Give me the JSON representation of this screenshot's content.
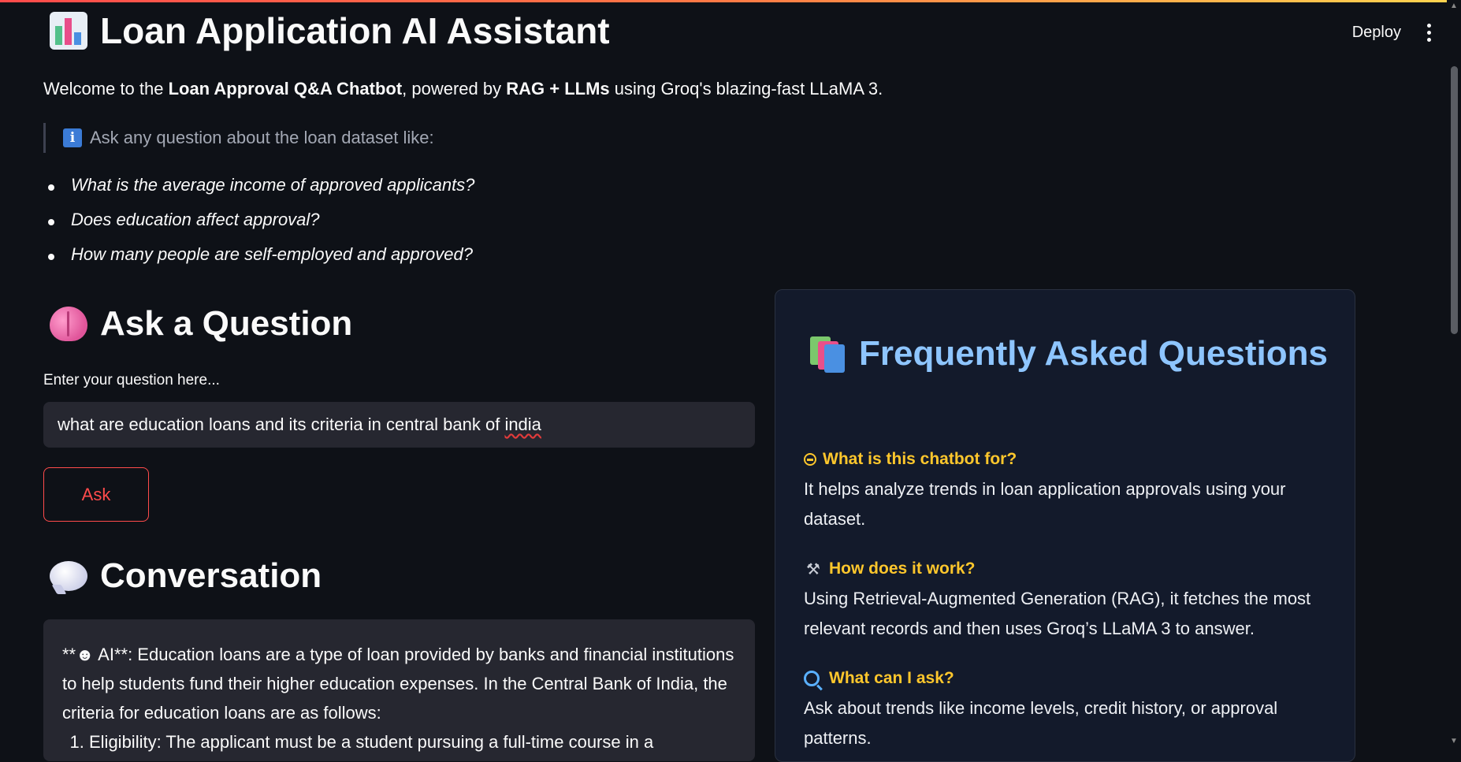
{
  "header": {
    "deploy_label": "Deploy",
    "menu_icon": "more-vertical-icon"
  },
  "app": {
    "title": "Loan Application AI Assistant",
    "title_icon": "bar-chart-icon"
  },
  "welcome": {
    "prefix": "Welcome to the ",
    "bold1": "Loan Approval Q&A Chatbot",
    "middle": ", powered by ",
    "bold2": "RAG + LLMs",
    "suffix": " using Groq's blazing-fast LLaMA 3."
  },
  "hint": {
    "icon": "info-icon",
    "text": "Ask any question about the loan dataset like:"
  },
  "examples": [
    "What is the average income of approved applicants?",
    "Does education affect approval?",
    "How many people are self-employed and approved?"
  ],
  "ask_section": {
    "title": "Ask a Question",
    "icon": "brain-icon",
    "input_label": "Enter your question here...",
    "input_value_main": "what are education loans and its criteria in central bank of ",
    "input_value_misspelled": "india",
    "button_label": "Ask"
  },
  "conversation": {
    "title": "Conversation",
    "icon": "speech-bubble-icon",
    "answer_line1": "**☻ AI**: Education loans are a type of loan provided by banks and financial institutions to help students fund their higher education expenses. In the Central Bank of India, the criteria for education loans are as follows:",
    "answer_item1": "Eligibility: The applicant must be a student pursuing a full-time course in a"
  },
  "faq": {
    "title": "Frequently Asked Questions",
    "icon": "books-icon",
    "items": [
      {
        "icon": "robot-icon",
        "question": "What is this chatbot for?",
        "answer": "It helps analyze trends in loan application approvals using your dataset."
      },
      {
        "icon": "tools-icon",
        "question": "How does it work?",
        "answer": "Using Retrieval-Augmented Generation (RAG), it fetches the most relevant records and then uses Groq’s LLaMA 3 to answer."
      },
      {
        "icon": "magnifier-icon",
        "question": "What can I ask?",
        "answer": "Ask about trends like income levels, credit history, or approval patterns."
      }
    ]
  },
  "colors": {
    "background": "#0e1117",
    "accent": "#ff4b4b",
    "faq_title": "#8ec5ff",
    "faq_question": "#ffc72c",
    "card_bg": "#131a2b",
    "input_bg": "#262730"
  }
}
